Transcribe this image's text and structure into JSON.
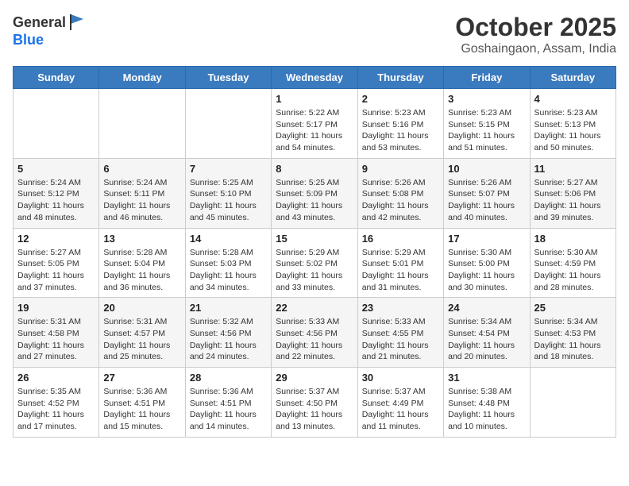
{
  "header": {
    "logo_general": "General",
    "logo_blue": "Blue",
    "month_title": "October 2025",
    "location": "Goshaingaon, Assam, India"
  },
  "weekdays": [
    "Sunday",
    "Monday",
    "Tuesday",
    "Wednesday",
    "Thursday",
    "Friday",
    "Saturday"
  ],
  "weeks": [
    [
      {
        "day": "",
        "info": ""
      },
      {
        "day": "",
        "info": ""
      },
      {
        "day": "",
        "info": ""
      },
      {
        "day": "1",
        "info": "Sunrise: 5:22 AM\nSunset: 5:17 PM\nDaylight: 11 hours\nand 54 minutes."
      },
      {
        "day": "2",
        "info": "Sunrise: 5:23 AM\nSunset: 5:16 PM\nDaylight: 11 hours\nand 53 minutes."
      },
      {
        "day": "3",
        "info": "Sunrise: 5:23 AM\nSunset: 5:15 PM\nDaylight: 11 hours\nand 51 minutes."
      },
      {
        "day": "4",
        "info": "Sunrise: 5:23 AM\nSunset: 5:13 PM\nDaylight: 11 hours\nand 50 minutes."
      }
    ],
    [
      {
        "day": "5",
        "info": "Sunrise: 5:24 AM\nSunset: 5:12 PM\nDaylight: 11 hours\nand 48 minutes."
      },
      {
        "day": "6",
        "info": "Sunrise: 5:24 AM\nSunset: 5:11 PM\nDaylight: 11 hours\nand 46 minutes."
      },
      {
        "day": "7",
        "info": "Sunrise: 5:25 AM\nSunset: 5:10 PM\nDaylight: 11 hours\nand 45 minutes."
      },
      {
        "day": "8",
        "info": "Sunrise: 5:25 AM\nSunset: 5:09 PM\nDaylight: 11 hours\nand 43 minutes."
      },
      {
        "day": "9",
        "info": "Sunrise: 5:26 AM\nSunset: 5:08 PM\nDaylight: 11 hours\nand 42 minutes."
      },
      {
        "day": "10",
        "info": "Sunrise: 5:26 AM\nSunset: 5:07 PM\nDaylight: 11 hours\nand 40 minutes."
      },
      {
        "day": "11",
        "info": "Sunrise: 5:27 AM\nSunset: 5:06 PM\nDaylight: 11 hours\nand 39 minutes."
      }
    ],
    [
      {
        "day": "12",
        "info": "Sunrise: 5:27 AM\nSunset: 5:05 PM\nDaylight: 11 hours\nand 37 minutes."
      },
      {
        "day": "13",
        "info": "Sunrise: 5:28 AM\nSunset: 5:04 PM\nDaylight: 11 hours\nand 36 minutes."
      },
      {
        "day": "14",
        "info": "Sunrise: 5:28 AM\nSunset: 5:03 PM\nDaylight: 11 hours\nand 34 minutes."
      },
      {
        "day": "15",
        "info": "Sunrise: 5:29 AM\nSunset: 5:02 PM\nDaylight: 11 hours\nand 33 minutes."
      },
      {
        "day": "16",
        "info": "Sunrise: 5:29 AM\nSunset: 5:01 PM\nDaylight: 11 hours\nand 31 minutes."
      },
      {
        "day": "17",
        "info": "Sunrise: 5:30 AM\nSunset: 5:00 PM\nDaylight: 11 hours\nand 30 minutes."
      },
      {
        "day": "18",
        "info": "Sunrise: 5:30 AM\nSunset: 4:59 PM\nDaylight: 11 hours\nand 28 minutes."
      }
    ],
    [
      {
        "day": "19",
        "info": "Sunrise: 5:31 AM\nSunset: 4:58 PM\nDaylight: 11 hours\nand 27 minutes."
      },
      {
        "day": "20",
        "info": "Sunrise: 5:31 AM\nSunset: 4:57 PM\nDaylight: 11 hours\nand 25 minutes."
      },
      {
        "day": "21",
        "info": "Sunrise: 5:32 AM\nSunset: 4:56 PM\nDaylight: 11 hours\nand 24 minutes."
      },
      {
        "day": "22",
        "info": "Sunrise: 5:33 AM\nSunset: 4:56 PM\nDaylight: 11 hours\nand 22 minutes."
      },
      {
        "day": "23",
        "info": "Sunrise: 5:33 AM\nSunset: 4:55 PM\nDaylight: 11 hours\nand 21 minutes."
      },
      {
        "day": "24",
        "info": "Sunrise: 5:34 AM\nSunset: 4:54 PM\nDaylight: 11 hours\nand 20 minutes."
      },
      {
        "day": "25",
        "info": "Sunrise: 5:34 AM\nSunset: 4:53 PM\nDaylight: 11 hours\nand 18 minutes."
      }
    ],
    [
      {
        "day": "26",
        "info": "Sunrise: 5:35 AM\nSunset: 4:52 PM\nDaylight: 11 hours\nand 17 minutes."
      },
      {
        "day": "27",
        "info": "Sunrise: 5:36 AM\nSunset: 4:51 PM\nDaylight: 11 hours\nand 15 minutes."
      },
      {
        "day": "28",
        "info": "Sunrise: 5:36 AM\nSunset: 4:51 PM\nDaylight: 11 hours\nand 14 minutes."
      },
      {
        "day": "29",
        "info": "Sunrise: 5:37 AM\nSunset: 4:50 PM\nDaylight: 11 hours\nand 13 minutes."
      },
      {
        "day": "30",
        "info": "Sunrise: 5:37 AM\nSunset: 4:49 PM\nDaylight: 11 hours\nand 11 minutes."
      },
      {
        "day": "31",
        "info": "Sunrise: 5:38 AM\nSunset: 4:48 PM\nDaylight: 11 hours\nand 10 minutes."
      },
      {
        "day": "",
        "info": ""
      }
    ]
  ]
}
